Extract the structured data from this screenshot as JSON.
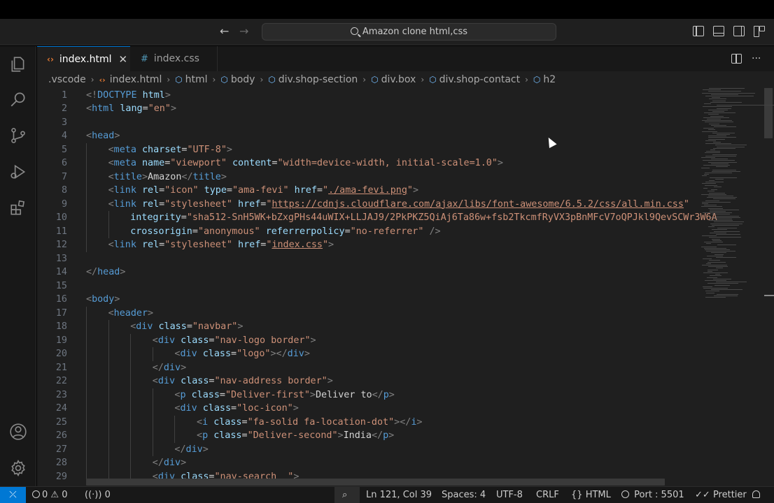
{
  "titlebar": {
    "search_text": "Amazon clone html,css",
    "back_icon": "←",
    "forward_icon": "→"
  },
  "tabs": [
    {
      "label": "index.html",
      "icon": "‹›",
      "close": "✕"
    },
    {
      "label": "index.css",
      "icon": "#"
    }
  ],
  "editor_actions": {
    "more": "···"
  },
  "breadcrumbs": [
    ".vscode",
    "index.html",
    "html",
    "body",
    "div.shop-section",
    "div.box",
    "div.shop-contact",
    "h2"
  ],
  "code_lines": [
    {
      "n": "1",
      "indent": 0,
      "tokens": [
        [
          "b",
          "<!"
        ],
        [
          "t",
          "DOCTYPE "
        ],
        [
          "a",
          "html"
        ],
        [
          "b",
          ">"
        ]
      ]
    },
    {
      "n": "2",
      "indent": 0,
      "tokens": [
        [
          "b",
          "<"
        ],
        [
          "t",
          "html "
        ],
        [
          "a",
          "lang"
        ],
        [
          "x",
          "="
        ],
        [
          "s",
          "\"en\""
        ],
        [
          "b",
          ">"
        ]
      ]
    },
    {
      "n": "3",
      "indent": 0,
      "tokens": []
    },
    {
      "n": "4",
      "indent": 0,
      "tokens": [
        [
          "b",
          "<"
        ],
        [
          "t",
          "head"
        ],
        [
          "b",
          ">"
        ]
      ]
    },
    {
      "n": "5",
      "indent": 1,
      "tokens": [
        [
          "b",
          "<"
        ],
        [
          "t",
          "meta "
        ],
        [
          "a",
          "charset"
        ],
        [
          "x",
          "="
        ],
        [
          "s",
          "\"UTF-8\""
        ],
        [
          "b",
          ">"
        ]
      ]
    },
    {
      "n": "6",
      "indent": 1,
      "tokens": [
        [
          "b",
          "<"
        ],
        [
          "t",
          "meta "
        ],
        [
          "a",
          "name"
        ],
        [
          "x",
          "="
        ],
        [
          "s",
          "\"viewport\""
        ],
        [
          "x",
          " "
        ],
        [
          "a",
          "content"
        ],
        [
          "x",
          "="
        ],
        [
          "s",
          "\"width=device-width, initial-scale=1.0\""
        ],
        [
          "b",
          ">"
        ]
      ]
    },
    {
      "n": "7",
      "indent": 1,
      "tokens": [
        [
          "b",
          "<"
        ],
        [
          "t",
          "title"
        ],
        [
          "b",
          ">"
        ],
        [
          "x",
          "Amazon"
        ],
        [
          "b",
          "</"
        ],
        [
          "t",
          "title"
        ],
        [
          "b",
          ">"
        ]
      ]
    },
    {
      "n": "8",
      "indent": 1,
      "tokens": [
        [
          "b",
          "<"
        ],
        [
          "t",
          "link "
        ],
        [
          "a",
          "rel"
        ],
        [
          "x",
          "="
        ],
        [
          "s",
          "\"icon\""
        ],
        [
          "x",
          " "
        ],
        [
          "a",
          "type"
        ],
        [
          "x",
          "="
        ],
        [
          "s",
          "\"ama-fevi\""
        ],
        [
          "x",
          " "
        ],
        [
          "a",
          "href"
        ],
        [
          "x",
          "="
        ],
        [
          "s",
          "\""
        ],
        [
          "l",
          "./ama-fevi.png"
        ],
        [
          "s",
          "\""
        ],
        [
          "b",
          ">"
        ]
      ]
    },
    {
      "n": "9",
      "indent": 1,
      "tokens": [
        [
          "b",
          "<"
        ],
        [
          "t",
          "link "
        ],
        [
          "a",
          "rel"
        ],
        [
          "x",
          "="
        ],
        [
          "s",
          "\"stylesheet\""
        ],
        [
          "x",
          " "
        ],
        [
          "a",
          "href"
        ],
        [
          "x",
          "="
        ],
        [
          "s",
          "\""
        ],
        [
          "l",
          "https://cdnjs.cloudflare.com/ajax/libs/font-awesome/6.5.2/css/all.min.css"
        ],
        [
          "s",
          "\""
        ]
      ]
    },
    {
      "n": "10",
      "indent": 2,
      "tokens": [
        [
          "a",
          "integrity"
        ],
        [
          "x",
          "="
        ],
        [
          "s",
          "\"sha512-SnH5WK+bZxgPHs44uWIX+LLJAJ9/2PkPKZ5QiAj6Ta86w+fsb2TkcmfRyVX3pBnMFcV7oQPJkl9QevSCWr3W6A"
        ]
      ]
    },
    {
      "n": "11",
      "indent": 2,
      "tokens": [
        [
          "a",
          "crossorigin"
        ],
        [
          "x",
          "="
        ],
        [
          "s",
          "\"anonymous\""
        ],
        [
          "x",
          " "
        ],
        [
          "a",
          "referrerpolicy"
        ],
        [
          "x",
          "="
        ],
        [
          "s",
          "\"no-referrer\""
        ],
        [
          "x",
          " "
        ],
        [
          "b",
          "/>"
        ]
      ]
    },
    {
      "n": "12",
      "indent": 1,
      "tokens": [
        [
          "b",
          "<"
        ],
        [
          "t",
          "link "
        ],
        [
          "a",
          "rel"
        ],
        [
          "x",
          "="
        ],
        [
          "s",
          "\"stylesheet\""
        ],
        [
          "x",
          " "
        ],
        [
          "a",
          "href"
        ],
        [
          "x",
          "="
        ],
        [
          "s",
          "\""
        ],
        [
          "l",
          "index.css"
        ],
        [
          "s",
          "\""
        ],
        [
          "b",
          ">"
        ]
      ]
    },
    {
      "n": "13",
      "indent": 0,
      "tokens": []
    },
    {
      "n": "14",
      "indent": 0,
      "tokens": [
        [
          "b",
          "</"
        ],
        [
          "t",
          "head"
        ],
        [
          "b",
          ">"
        ]
      ]
    },
    {
      "n": "15",
      "indent": 0,
      "tokens": []
    },
    {
      "n": "16",
      "indent": 0,
      "tokens": [
        [
          "b",
          "<"
        ],
        [
          "t",
          "body"
        ],
        [
          "b",
          ">"
        ]
      ]
    },
    {
      "n": "17",
      "indent": 1,
      "tokens": [
        [
          "b",
          "<"
        ],
        [
          "t",
          "header"
        ],
        [
          "b",
          ">"
        ]
      ]
    },
    {
      "n": "18",
      "indent": 2,
      "tokens": [
        [
          "b",
          "<"
        ],
        [
          "t",
          "div "
        ],
        [
          "a",
          "class"
        ],
        [
          "x",
          "="
        ],
        [
          "s",
          "\"navbar\""
        ],
        [
          "b",
          ">"
        ]
      ]
    },
    {
      "n": "19",
      "indent": 3,
      "tokens": [
        [
          "b",
          "<"
        ],
        [
          "t",
          "div "
        ],
        [
          "a",
          "class"
        ],
        [
          "x",
          "="
        ],
        [
          "s",
          "\"nav-logo border\""
        ],
        [
          "b",
          ">"
        ]
      ]
    },
    {
      "n": "20",
      "indent": 4,
      "tokens": [
        [
          "b",
          "<"
        ],
        [
          "t",
          "div "
        ],
        [
          "a",
          "class"
        ],
        [
          "x",
          "="
        ],
        [
          "s",
          "\"logo\""
        ],
        [
          "b",
          "></"
        ],
        [
          "t",
          "div"
        ],
        [
          "b",
          ">"
        ]
      ]
    },
    {
      "n": "21",
      "indent": 3,
      "tokens": [
        [
          "b",
          "</"
        ],
        [
          "t",
          "div"
        ],
        [
          "b",
          ">"
        ]
      ]
    },
    {
      "n": "22",
      "indent": 3,
      "tokens": [
        [
          "b",
          "<"
        ],
        [
          "t",
          "div "
        ],
        [
          "a",
          "class"
        ],
        [
          "x",
          "="
        ],
        [
          "s",
          "\"nav-address border\""
        ],
        [
          "b",
          ">"
        ]
      ]
    },
    {
      "n": "23",
      "indent": 4,
      "tokens": [
        [
          "b",
          "<"
        ],
        [
          "t",
          "p "
        ],
        [
          "a",
          "class"
        ],
        [
          "x",
          "="
        ],
        [
          "s",
          "\"Deliver-first\""
        ],
        [
          "b",
          ">"
        ],
        [
          "x",
          "Deliver to"
        ],
        [
          "b",
          "</"
        ],
        [
          "t",
          "p"
        ],
        [
          "b",
          ">"
        ]
      ]
    },
    {
      "n": "24",
      "indent": 4,
      "tokens": [
        [
          "b",
          "<"
        ],
        [
          "t",
          "div "
        ],
        [
          "a",
          "class"
        ],
        [
          "x",
          "="
        ],
        [
          "s",
          "\"loc-icon\""
        ],
        [
          "b",
          ">"
        ]
      ]
    },
    {
      "n": "25",
      "indent": 5,
      "tokens": [
        [
          "b",
          "<"
        ],
        [
          "t",
          "i "
        ],
        [
          "a",
          "class"
        ],
        [
          "x",
          "="
        ],
        [
          "s",
          "\"fa-solid fa-location-dot\""
        ],
        [
          "b",
          "></"
        ],
        [
          "t",
          "i"
        ],
        [
          "b",
          ">"
        ]
      ]
    },
    {
      "n": "26",
      "indent": 5,
      "tokens": [
        [
          "b",
          "<"
        ],
        [
          "t",
          "p "
        ],
        [
          "a",
          "class"
        ],
        [
          "x",
          "="
        ],
        [
          "s",
          "\"Deliver-second\""
        ],
        [
          "b",
          ">"
        ],
        [
          "x",
          "India"
        ],
        [
          "b",
          "</"
        ],
        [
          "t",
          "p"
        ],
        [
          "b",
          ">"
        ]
      ]
    },
    {
      "n": "27",
      "indent": 4,
      "tokens": [
        [
          "b",
          "</"
        ],
        [
          "t",
          "div"
        ],
        [
          "b",
          ">"
        ]
      ]
    },
    {
      "n": "28",
      "indent": 3,
      "tokens": [
        [
          "b",
          "</"
        ],
        [
          "t",
          "div"
        ],
        [
          "b",
          ">"
        ]
      ]
    },
    {
      "n": "29",
      "indent": 3,
      "tokens": [
        [
          "b",
          "<"
        ],
        [
          "t",
          "div "
        ],
        [
          "a",
          "class"
        ],
        [
          "x",
          "="
        ],
        [
          "s",
          "\"nav-search  \""
        ],
        [
          "b",
          ">"
        ]
      ]
    }
  ],
  "statusbar": {
    "remote_icon": "⤫",
    "errors": "0",
    "warnings": "0",
    "ports": "0",
    "position": "Ln 121, Col 39",
    "spaces": "Spaces: 4",
    "encoding": "UTF-8",
    "eol": "CRLF",
    "language": "HTML",
    "port": "Port : 5501",
    "prettier": "Prettier"
  }
}
